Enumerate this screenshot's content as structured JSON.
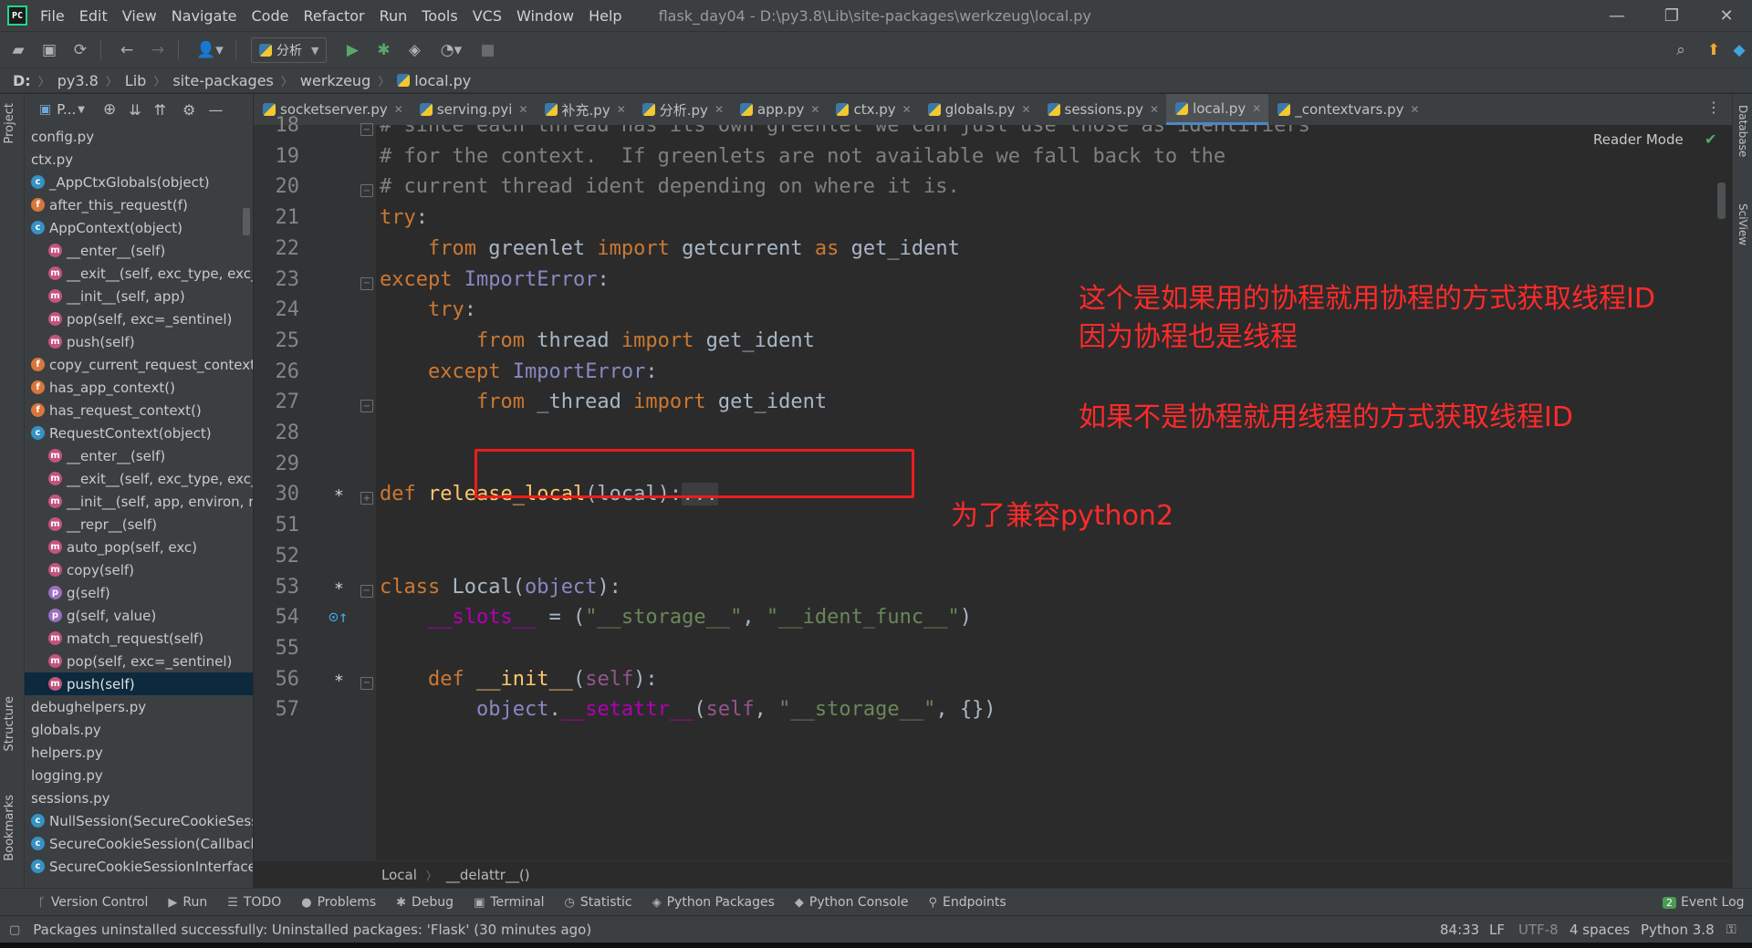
{
  "menubar": {
    "items": [
      "File",
      "Edit",
      "View",
      "Navigate",
      "Code",
      "Refactor",
      "Run",
      "Tools",
      "VCS",
      "Window",
      "Help"
    ],
    "title": "flask_day04 - D:\\py3.8\\Lib\\site-packages\\werkzeug\\local.py"
  },
  "toolbar": {
    "run_config": "分析"
  },
  "breadcrumb": [
    "D:",
    "py3.8",
    "Lib",
    "site-packages",
    "werkzeug",
    "local.py"
  ],
  "left_strip": {
    "project": "Project",
    "structure": "Structure",
    "bookmarks": "Bookmarks"
  },
  "right_strip": {
    "database": "Database",
    "sciview": "SciView"
  },
  "project_panel": {
    "title": "P...",
    "tree": [
      {
        "label": "config.py",
        "icon": "none",
        "indent": 0
      },
      {
        "label": "ctx.py",
        "icon": "none",
        "indent": 0
      },
      {
        "label": "_AppCtxGlobals(object)",
        "icon": "c",
        "indent": 1
      },
      {
        "label": "after_this_request(f)",
        "icon": "f",
        "indent": 1
      },
      {
        "label": "AppContext(object)",
        "icon": "c",
        "indent": 1
      },
      {
        "label": "__enter__(self)",
        "icon": "m",
        "indent": 2
      },
      {
        "label": "__exit__(self, exc_type, exc_",
        "icon": "m",
        "indent": 2
      },
      {
        "label": "__init__(self, app)",
        "icon": "m",
        "indent": 2
      },
      {
        "label": "pop(self, exc=_sentinel)",
        "icon": "m",
        "indent": 2
      },
      {
        "label": "push(self)",
        "icon": "m",
        "indent": 2
      },
      {
        "label": "copy_current_request_context",
        "icon": "f",
        "indent": 1
      },
      {
        "label": "has_app_context()",
        "icon": "f",
        "indent": 1
      },
      {
        "label": "has_request_context()",
        "icon": "f",
        "indent": 1
      },
      {
        "label": "RequestContext(object)",
        "icon": "c",
        "indent": 1
      },
      {
        "label": "__enter__(self)",
        "icon": "m",
        "indent": 2
      },
      {
        "label": "__exit__(self, exc_type, exc_",
        "icon": "m",
        "indent": 2
      },
      {
        "label": "__init__(self, app, environ, re",
        "icon": "m",
        "indent": 2
      },
      {
        "label": "__repr__(self)",
        "icon": "m",
        "indent": 2
      },
      {
        "label": "auto_pop(self, exc)",
        "icon": "m",
        "indent": 2
      },
      {
        "label": "copy(self)",
        "icon": "m",
        "indent": 2
      },
      {
        "label": "g(self)",
        "icon": "p",
        "indent": 2
      },
      {
        "label": "g(self, value)",
        "icon": "p",
        "indent": 2
      },
      {
        "label": "match_request(self)",
        "icon": "m",
        "indent": 2
      },
      {
        "label": "pop(self, exc=_sentinel)",
        "icon": "m",
        "indent": 2
      },
      {
        "label": "push(self)",
        "icon": "m",
        "indent": 2,
        "selected": true
      },
      {
        "label": "debughelpers.py",
        "icon": "none",
        "indent": 0
      },
      {
        "label": "globals.py",
        "icon": "none",
        "indent": 0
      },
      {
        "label": "helpers.py",
        "icon": "none",
        "indent": 0
      },
      {
        "label": "logging.py",
        "icon": "none",
        "indent": 0
      },
      {
        "label": "sessions.py",
        "icon": "none",
        "indent": 0
      },
      {
        "label": "NullSession(SecureCookieSess",
        "icon": "c",
        "indent": 1
      },
      {
        "label": "SecureCookieSession(Callback",
        "icon": "c",
        "indent": 1
      },
      {
        "label": "SecureCookieSessionInterface",
        "icon": "c",
        "indent": 1
      }
    ]
  },
  "tabs": [
    {
      "label": "socketserver.py",
      "active": false
    },
    {
      "label": "serving.pyi",
      "active": false
    },
    {
      "label": "补充.py",
      "active": false
    },
    {
      "label": "分析.py",
      "active": false
    },
    {
      "label": "app.py",
      "active": false
    },
    {
      "label": "ctx.py",
      "active": false
    },
    {
      "label": "globals.py",
      "active": false
    },
    {
      "label": "sessions.py",
      "active": false
    },
    {
      "label": "local.py",
      "active": true
    },
    {
      "label": "_contextvars.py",
      "active": false
    }
  ],
  "editor": {
    "reader_mode": "Reader Mode",
    "lines": [
      {
        "n": "18",
        "segs": [
          [
            "cm",
            "# since each thread has its own greenlet we can just use those as identifiers"
          ]
        ]
      },
      {
        "n": "19",
        "segs": [
          [
            "cm",
            "# for the context.  If greenlets are not available we fall back to the"
          ]
        ]
      },
      {
        "n": "20",
        "segs": [
          [
            "cm",
            "# current thread ident depending on where it is."
          ]
        ]
      },
      {
        "n": "21",
        "segs": [
          [
            "kw",
            "try"
          ],
          [
            "plain",
            ":"
          ]
        ]
      },
      {
        "n": "22",
        "segs": [
          [
            "plain",
            "    "
          ],
          [
            "kw",
            "from"
          ],
          [
            "plain",
            " greenlet "
          ],
          [
            "kw",
            "import"
          ],
          [
            "plain",
            " getcurrent "
          ],
          [
            "kw",
            "as"
          ],
          [
            "plain",
            " get_ident"
          ]
        ]
      },
      {
        "n": "23",
        "segs": [
          [
            "kw",
            "except"
          ],
          [
            "plain",
            " "
          ],
          [
            "bi",
            "ImportError"
          ],
          [
            "plain",
            ":"
          ]
        ]
      },
      {
        "n": "24",
        "segs": [
          [
            "plain",
            "    "
          ],
          [
            "kw",
            "try"
          ],
          [
            "plain",
            ":"
          ]
        ]
      },
      {
        "n": "25",
        "segs": [
          [
            "plain",
            "        "
          ],
          [
            "kw",
            "from"
          ],
          [
            "plain",
            " thread "
          ],
          [
            "kw",
            "import"
          ],
          [
            "plain",
            " get_ident"
          ]
        ]
      },
      {
        "n": "26",
        "segs": [
          [
            "plain",
            "    "
          ],
          [
            "kw",
            "except"
          ],
          [
            "plain",
            " "
          ],
          [
            "bi",
            "ImportError"
          ],
          [
            "plain",
            ":"
          ]
        ]
      },
      {
        "n": "27",
        "segs": [
          [
            "plain",
            "        "
          ],
          [
            "kw",
            "from"
          ],
          [
            "plain",
            " _thread "
          ],
          [
            "kw",
            "import"
          ],
          [
            "plain",
            " get_ident"
          ]
        ]
      },
      {
        "n": "28",
        "segs": []
      },
      {
        "n": "29",
        "segs": []
      },
      {
        "n": "30",
        "segs": [
          [
            "kw",
            "def"
          ],
          [
            "plain",
            " "
          ],
          [
            "fn",
            "release_local"
          ],
          [
            "plain",
            "(local):"
          ],
          [
            "foldbox",
            "..."
          ]
        ]
      },
      {
        "n": "51",
        "segs": []
      },
      {
        "n": "52",
        "segs": []
      },
      {
        "n": "53",
        "segs": [
          [
            "kw",
            "class"
          ],
          [
            "plain",
            " Local("
          ],
          [
            "bi",
            "object"
          ],
          [
            "plain",
            "):"
          ]
        ]
      },
      {
        "n": "54",
        "segs": [
          [
            "plain",
            "    "
          ],
          [
            "dun",
            "__slots__"
          ],
          [
            "plain",
            " = ("
          ],
          [
            "str",
            "\"__storage__\""
          ],
          [
            "plain",
            ", "
          ],
          [
            "str",
            "\"__ident_func__\""
          ],
          [
            "plain",
            ")"
          ]
        ]
      },
      {
        "n": "55",
        "segs": []
      },
      {
        "n": "56",
        "segs": [
          [
            "plain",
            "    "
          ],
          [
            "kw",
            "def"
          ],
          [
            "plain",
            " "
          ],
          [
            "fn",
            "__init__"
          ],
          [
            "plain",
            "("
          ],
          [
            "slf",
            "self"
          ],
          [
            "plain",
            "):"
          ]
        ]
      },
      {
        "n": "57",
        "segs": [
          [
            "plain",
            "        "
          ],
          [
            "bi",
            "object"
          ],
          [
            "plain",
            "."
          ],
          [
            "dun",
            "__setattr__"
          ],
          [
            "plain",
            "("
          ],
          [
            "slf",
            "self"
          ],
          [
            "plain",
            ", "
          ],
          [
            "str",
            "\"__storage__\""
          ],
          [
            "plain",
            ", {})"
          ]
        ]
      }
    ],
    "annotations": {
      "line1": "这个是如果用的协程就用协程的方式获取线程ID",
      "line2": "因为协程也是线程",
      "line3": "如果不是协程就用线程的方式获取线程ID",
      "line4": "为了兼容python2"
    },
    "crumbs": [
      "Local",
      "__delattr__()"
    ]
  },
  "bottom_tools": [
    "Version Control",
    "Run",
    "TODO",
    "Problems",
    "Debug",
    "Terminal",
    "Statistic",
    "Python Packages",
    "Python Console",
    "Endpoints"
  ],
  "event_log": {
    "count": "2",
    "label": "Event Log"
  },
  "status": {
    "message": "Packages uninstalled successfully: Uninstalled packages: 'Flask' (30 minutes ago)",
    "position": "84:33",
    "line_sep": "LF",
    "encoding": "UTF-8",
    "indent": "4 spaces",
    "interpreter": "Python 3.8"
  },
  "colors": {
    "keyword": "#cc7832",
    "comment": "#808080",
    "string": "#6a8759",
    "function": "#ffc66d",
    "annotation": "#ff2a2a",
    "accent": "#4a88c7"
  }
}
